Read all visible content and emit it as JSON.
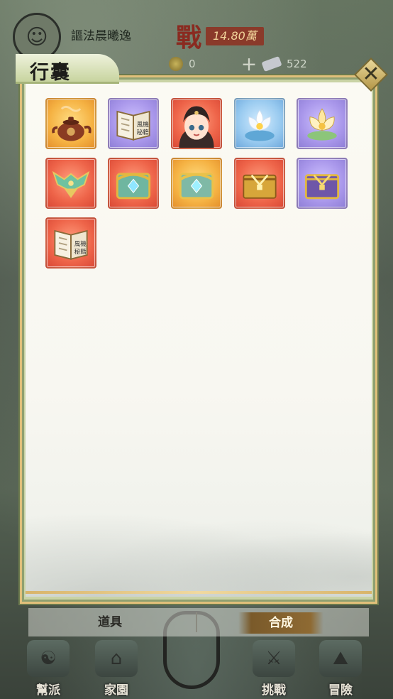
{
  "background": {
    "player_name": "謳法晨曦逸",
    "power_label": "戰",
    "power_value": "14.80萬",
    "resources": [
      {
        "icon": "coin-icon",
        "value": "0"
      },
      {
        "icon": "coin-icon",
        "value": "0"
      },
      {
        "icon": "gem-icon",
        "value": "522"
      }
    ],
    "nav": [
      {
        "key": "sect",
        "label": "幫派"
      },
      {
        "key": "home",
        "label": "家園"
      },
      {
        "key": "challenge",
        "label": "挑戰"
      },
      {
        "key": "adventure",
        "label": "冒險"
      }
    ]
  },
  "inventory": {
    "title": "行囊",
    "close_icon": "close-icon",
    "items": [
      {
        "name": "teapot",
        "rarity": "orange"
      },
      {
        "name": "skill-book",
        "rarity": "purple"
      },
      {
        "name": "character-portrait",
        "rarity": "red"
      },
      {
        "name": "white-lotus",
        "rarity": "blue"
      },
      {
        "name": "golden-lotus",
        "rarity": "purple"
      },
      {
        "name": "jade-armor",
        "rarity": "red"
      },
      {
        "name": "jeweled-chest-red",
        "rarity": "red"
      },
      {
        "name": "jeweled-chest-gold",
        "rarity": "orange"
      },
      {
        "name": "treasure-chest-red",
        "rarity": "red"
      },
      {
        "name": "treasure-chest-purple",
        "rarity": "purple"
      },
      {
        "name": "skill-book-red",
        "rarity": "red"
      }
    ],
    "tabs": {
      "items": "道具",
      "synthesize": "合成"
    },
    "colors": {
      "orange": "#f5b243",
      "purple": "#a896ea",
      "blue": "#97c9ef",
      "red": "#ee6449",
      "frame": "#c9d3a5",
      "gold": "#e1c07b"
    }
  }
}
